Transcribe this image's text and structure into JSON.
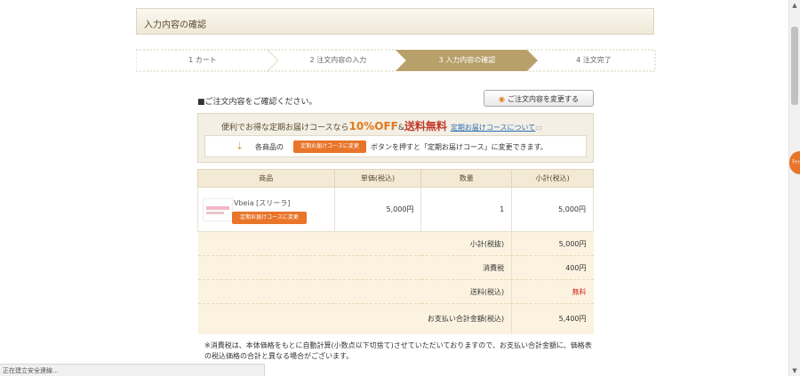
{
  "page_title": "入力内容の確認",
  "steps": [
    {
      "label": "1  カート"
    },
    {
      "label": "2  注文内容の入力"
    },
    {
      "label": "3  入力内容の確認"
    },
    {
      "label": "4  注文完了"
    }
  ],
  "notice": "■ご注文内容をご確認ください。",
  "change_button": {
    "icon": "orange-dot-icon",
    "label": "ご注文内容を変更する"
  },
  "promo": {
    "text_before": "便利でお得な定期お届けコースなら",
    "discount": "10%OFF",
    "amp": "&",
    "free_shipping": "送料無料",
    "link": "定期お届けコースについて",
    "instr_prefix": "各商品の",
    "badge": "定期お届けコースに変更",
    "instr_suffix": "ボタンを押すと「定期お届けコース」に変更できます。"
  },
  "table": {
    "headers": [
      "商品",
      "単価(税込)",
      "数量",
      "小計(税込)"
    ],
    "item": {
      "name": "Vbeia [スリーラ]",
      "badge": "定期お届けコースに変更",
      "price": "5,000円",
      "qty": "1",
      "subtotal": "5,000円"
    },
    "summary": [
      {
        "label": "小計(税抜)",
        "value": "5,000円"
      },
      {
        "label": "消費税",
        "value": "400円"
      },
      {
        "label": "送料(税込)",
        "value": "無料"
      }
    ],
    "total": {
      "label": "お支払い合計金額(税込)",
      "value": "5,400円"
    }
  },
  "footnote": "※消費税は、本体価格をもとに自動計算(小数点以下切捨て)させていただいておりますので、お支払い合計金額に、価格表の税込価格の合計と異なる場合がございます。",
  "status_bar": "正在建立安全連線...",
  "side_tab": "ﾁｬｯﾄ",
  "colors": {
    "accent": "#e8752a",
    "step_active": "#b8a06a",
    "header_bg": "#f3ead6"
  }
}
